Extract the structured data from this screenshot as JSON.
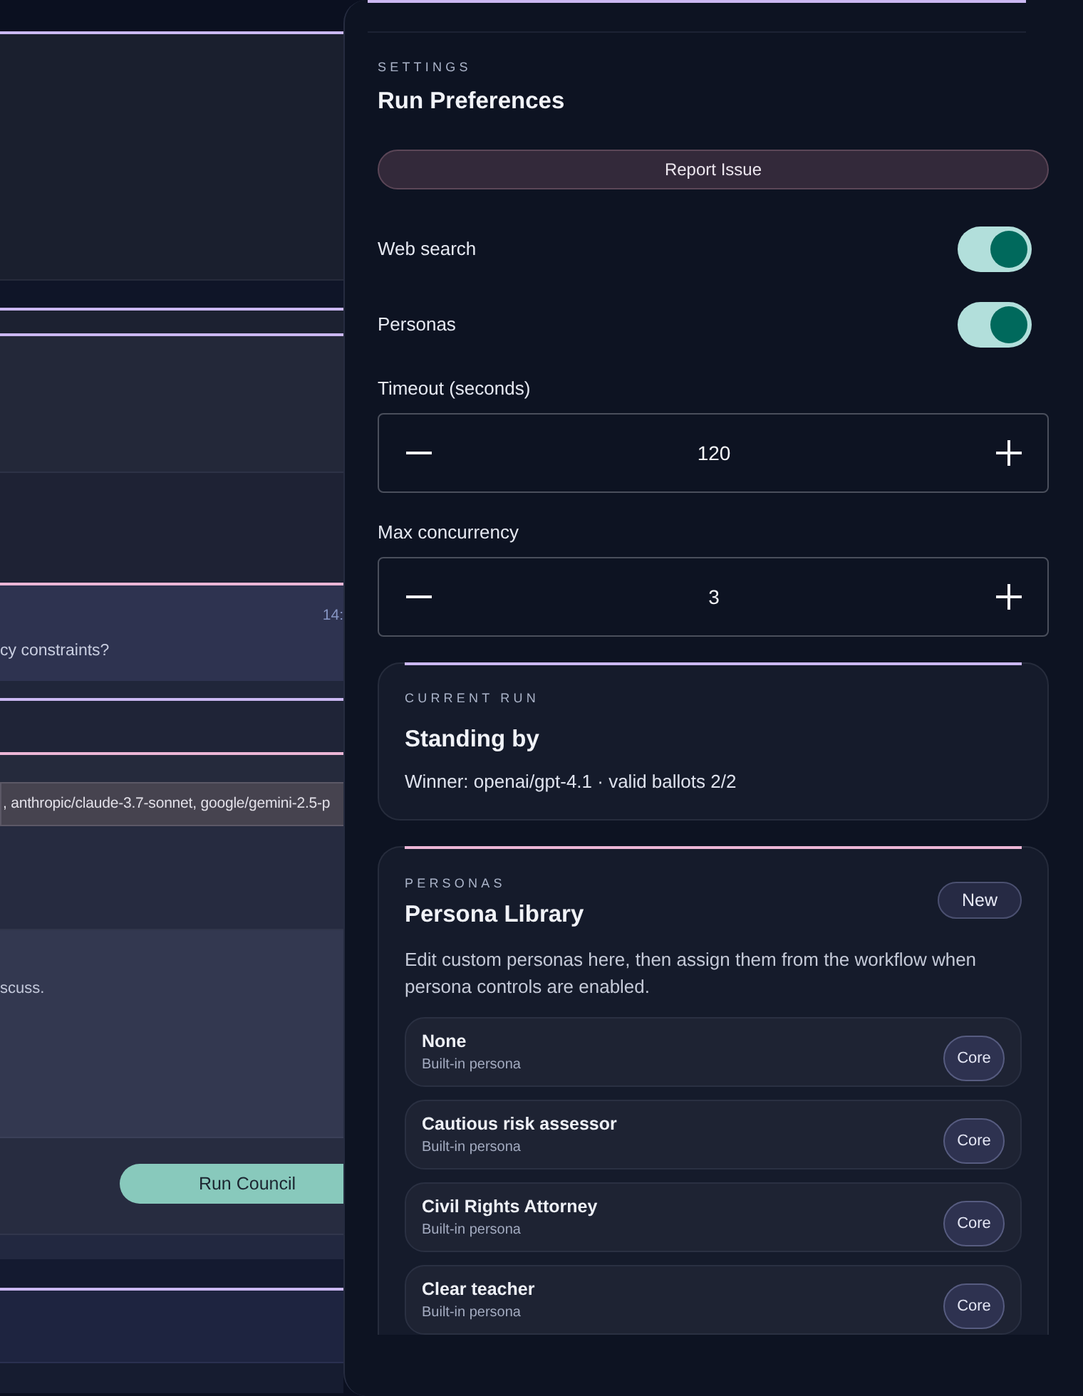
{
  "background_page": {
    "timestamp": "14:",
    "question_fragment": "cy constraints?",
    "models_field": {
      "value": ", anthropic/claude-3.7-sonnet, google/gemini-2.5-p"
    },
    "prompt_fragment": "scuss.",
    "run_button": "Run Council"
  },
  "drawer": {
    "eyebrow": "SETTINGS",
    "title": "Run Preferences",
    "report_button": "Report Issue",
    "toggles": [
      {
        "label": "Web search",
        "on": true
      },
      {
        "label": "Personas",
        "on": true
      }
    ],
    "steppers": [
      {
        "label": "Timeout (seconds)",
        "value": "120"
      },
      {
        "label": "Max concurrency",
        "value": "3"
      }
    ],
    "current_run": {
      "eyebrow": "CURRENT RUN",
      "title": "Standing by",
      "summary": "Winner: openai/gpt-4.1 · valid ballots 2/2"
    },
    "personas": {
      "eyebrow": "PERSONAS",
      "title": "Persona Library",
      "new_button": "New",
      "description": "Edit custom personas here, then assign them from the workflow when persona controls are enabled.",
      "items": [
        {
          "name": "None",
          "subtitle": "Built-in persona",
          "tag": "Core"
        },
        {
          "name": "Cautious risk assessor",
          "subtitle": "Built-in persona",
          "tag": "Core"
        },
        {
          "name": "Civil Rights Attorney",
          "subtitle": "Built-in persona",
          "tag": "Core"
        },
        {
          "name": "Clear teacher",
          "subtitle": "Built-in persona",
          "tag": "Core"
        }
      ]
    }
  }
}
